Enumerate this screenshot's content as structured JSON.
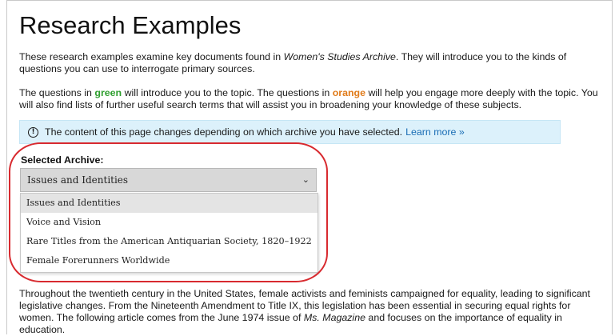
{
  "page": {
    "title": "Research Examples",
    "intro": {
      "before": "These research examples examine key documents found in ",
      "archive_name": "Women's Studies Archive",
      "after": ". They will introduce you to the kinds of questions you can use to interrogate primary sources."
    },
    "guide": {
      "part1": "The questions in ",
      "green_word": "green",
      "part2": " will introduce you to the topic. The questions in ",
      "orange_word": "orange",
      "part3": " will help you engage more deeply with the topic. You will also find lists of further useful search terms that will assist you in broadening your knowledge of these subjects."
    },
    "notice": {
      "icon": "info-icon",
      "text": "The content of this page changes depending on which archive you have selected.",
      "link": "Learn more »"
    },
    "archive_select": {
      "label": "Selected Archive:",
      "selected": "Issues and Identities",
      "chevron": "⌄",
      "options": [
        "Issues and Identities",
        "Voice and Vision",
        "Rare Titles from the American Antiquarian Society, 1820–1922",
        "Female Forerunners Worldwide"
      ]
    },
    "body": {
      "part1": "Throughout the twentieth century in the United States, female activists and feminists campaigned for equality, leading to significant legislative changes. From the Nineteenth Amendment to Title IX, this legislation has been essential in securing equal rights for women. The following article comes from the June 1974 issue of ",
      "magazine": "Ms. Magazine",
      "part2": " and focuses on the importance of equality in education."
    },
    "colors": {
      "green": "#2e9e2e",
      "orange": "#e07b1a",
      "notice_bg": "#dcf1fb",
      "link": "#1a6db5",
      "highlight": "#d82a2f"
    }
  }
}
